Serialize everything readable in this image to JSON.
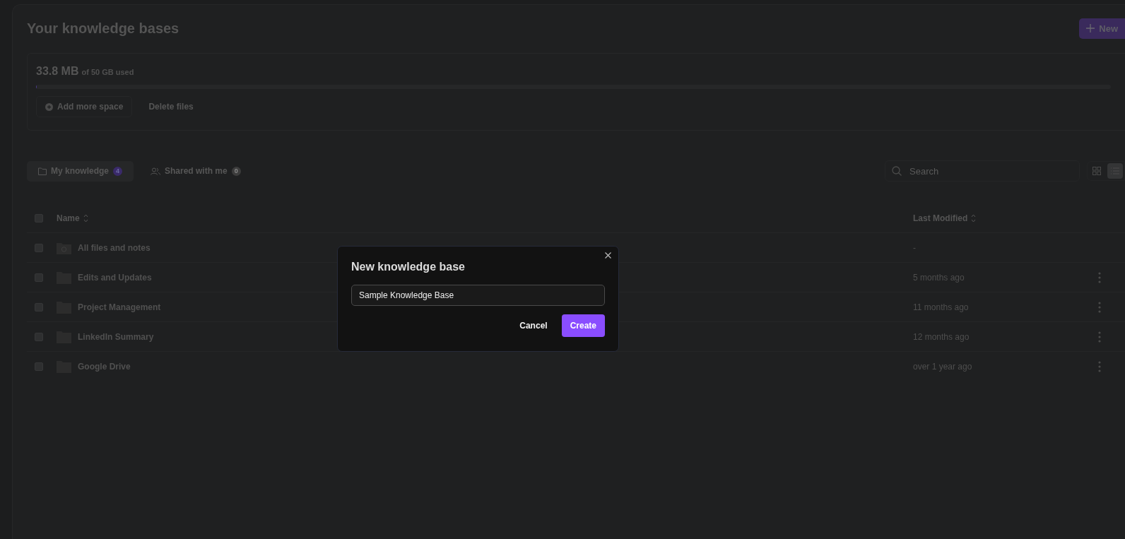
{
  "header": {
    "title": "Your knowledge bases",
    "new_button": "New"
  },
  "storage": {
    "used": "33.8 MB",
    "total": "of 50 GB used",
    "level": 0.0007,
    "actions": [
      "Add more space",
      "Delete files"
    ]
  },
  "tabs": [
    {
      "label": "My knowledge",
      "count": "4",
      "selected": true
    },
    {
      "label": "Shared with me",
      "count": "0",
      "selected": false
    }
  ],
  "search": {
    "placeholder": "Search"
  },
  "view_toggle": [
    {
      "kind": "grid",
      "selected": false
    },
    {
      "kind": "list",
      "selected": true
    }
  ],
  "table": {
    "select_all_checked": false,
    "columns": [
      "Name",
      "Last Modified"
    ],
    "rows": [
      {
        "kind": "all",
        "name": "All files and notes",
        "modified": "-",
        "checked": false
      },
      {
        "kind": "folder",
        "name": "Edits and Updates",
        "modified": "5 months ago",
        "checked": false
      },
      {
        "kind": "folder",
        "name": "Project Management",
        "modified": "11 months ago",
        "checked": false
      },
      {
        "kind": "folder",
        "name": "LinkedIn Summary",
        "modified": "12 months ago",
        "checked": false
      },
      {
        "kind": "folder",
        "name": "Google Drive",
        "modified": "over 1 year ago",
        "checked": false
      }
    ]
  },
  "dialog": {
    "title": "New knowledge base",
    "value": "Sample Knowledge Base",
    "cancel": "Cancel",
    "create": "Create"
  }
}
